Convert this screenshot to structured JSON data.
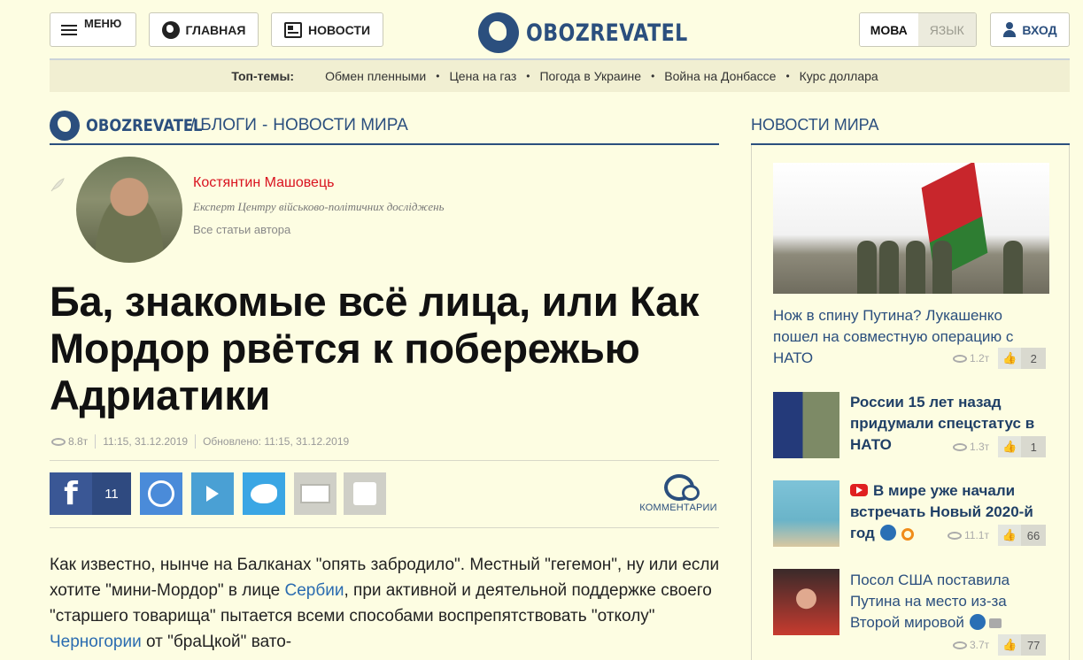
{
  "header": {
    "menu_label": "МЕНЮ",
    "home_label": "ГЛАВНАЯ",
    "news_label": "НОВОСТИ",
    "logo_text": "OBOZREVATEL",
    "lang_ua": "МОВА",
    "lang_ru": "ЯЗЫК",
    "login_label": "ВХОД"
  },
  "topics": {
    "label": "Топ-темы:",
    "items": [
      "Обмен пленными",
      "Цена на газ",
      "Погода в Украине",
      "Война на Донбассе",
      "Курс доллара"
    ]
  },
  "breadcrumb": {
    "brand": "OBOZREVATEL",
    "sep1": "/",
    "section": "БЛОГИ",
    "sep2": "-",
    "subsection": "НОВОСТИ МИРА"
  },
  "author": {
    "name": "Костянтин Машовець",
    "description": "Експерт Центру військово-політичних досліджень",
    "all_articles": "Все статьи автора"
  },
  "article": {
    "title": "Ба, знакомые всё лица, или Как Мордор рвётся к побережью Адриатики",
    "views": "8.8т",
    "published": "11:15, 31.12.2019",
    "updated": "Обновлено: 11:15, 31.12.2019",
    "fb_count": "11",
    "comments_label": "КОММЕНТАРИИ",
    "body": {
      "p1_a": "Как известно, нынче на Балканах \"опять забродило\". Местный \"гегемон\", ну или если хотите \"мини-Мордор\" в лице ",
      "link1": "Сербии",
      "p1_b": ", при активной и деятельной поддержке своего \"старшего товарища\" пытается всеми способами воспрепятствовать \"отколу\" ",
      "link2": "Черногории",
      "p1_c": " от \"браЦкой\" вато-"
    }
  },
  "sidebar": {
    "title": "НОВОСТИ МИРА",
    "items": [
      {
        "title": "Нож в спину Путина? Лукашенко пошел на совместную операцию с НАТО",
        "views": "1.2т",
        "likes": "2"
      },
      {
        "title": "России 15 лет назад придумали спецстатус в НАТО",
        "views": "1.3т",
        "likes": "1"
      },
      {
        "title": "В мире уже начали встречать Новый 2020-й год",
        "views": "11.1т",
        "likes": "66"
      },
      {
        "title": "Посол США поставила Путина на место из-за Второй мировой",
        "views": "3.7т",
        "likes": "77"
      }
    ]
  }
}
